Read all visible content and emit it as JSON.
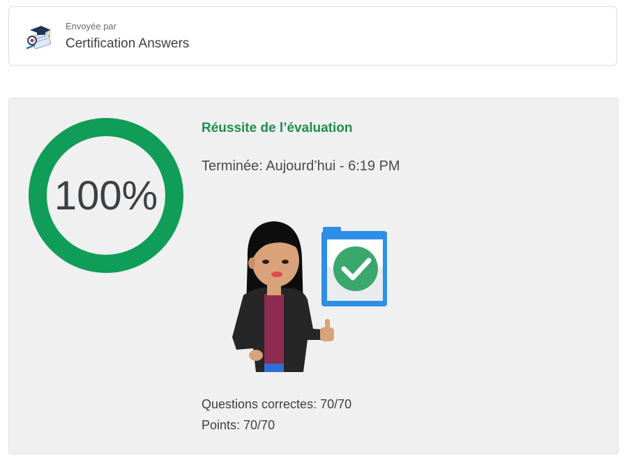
{
  "sender": {
    "caption": "Envoyée par",
    "name": "Certification Answers",
    "avatar_icon": "graduation-cap-logo-icon"
  },
  "result": {
    "score_percent": 100,
    "score_label": "100%",
    "title": "Réussite de l’évaluation",
    "completed": "Terminée: Aujourd’hui - 6:19 PM",
    "questions_correct": "Questions correctes: 70/70",
    "points": "Points: 70/70",
    "illustration_icon": "woman-thumbs-up-checklist-icon"
  },
  "colors": {
    "ring": "#0f9d58",
    "title": "#1e8e4e",
    "panel_bg": "#f0f0f0",
    "check_blue": "#2d8ee6",
    "check_green": "#3aa76d"
  }
}
